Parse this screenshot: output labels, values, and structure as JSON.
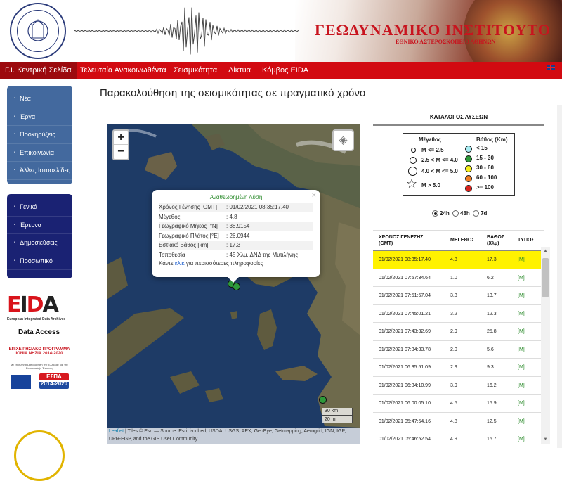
{
  "header": {
    "institute_title": "ΓΕΩΔΥΝΑΜΙΚΟ ΙΝΣΤΙΤΟΥΤΟ",
    "institute_subtitle": "ΕΘΝΙΚΟ ΑΣΤΕΡΟΣΚΟΠΕΙΟ ΑΘΗΝΩΝ",
    "logo_text": "NATIONAL OBSERVATORY ATHENS"
  },
  "nav": {
    "items": [
      "Γ.Ι. Κεντρική Σελίδα",
      "Τελευταία Ανακοινωθέντα",
      "Σεισμικότητα",
      "Δίκτυα",
      "Κόμβος EIDA"
    ],
    "language_flag_icon": "uk-flag-icon"
  },
  "sidebar": {
    "group1": [
      "Νέα",
      "Έργα",
      "Προκηρύξεις",
      "Επικοινωνία",
      "Άλλες Ιστοσελίδες"
    ],
    "group2": [
      "Γενικά",
      "Έρευνα",
      "Δημοσιεύσεις",
      "Προσωπικό"
    ],
    "eida_logo": "EIDA",
    "eida_caption": "European Integrated Data Archives",
    "data_access": "Data Access",
    "espa_program": "ΕΠΙΧΕΙΡΗΣΙΑΚΟ ΠΡΟΓΡΑΜΜΑ ΙΟΝΙΑ ΝΗΣΙΑ 2014-2020",
    "espa_cofunding": "Με τη συγχρηματοδότηση της Ελλάδας και της Ευρωπαϊκής Ένωσης",
    "espa_logo": "ΕΣΠΑ 2014-2020"
  },
  "page_title": "Παρακολούθηση της σεισμικότητας σε πραγματικό χρόνο",
  "map": {
    "zoom_in": "+",
    "zoom_out": "−",
    "scale_km": "30 km",
    "scale_mi": "20 mi",
    "attribution_leaflet": "Leaflet",
    "attribution": "| Tiles © Esri — Source: Esri, i-cubed, USDA, USGS, AEX, GeoEye, Getmapping, Aerogrid, IGN, IGP, UPR-EGP, and the GIS User Community",
    "popup": {
      "title": "Αναθεωρημένη Λύση",
      "close": "×",
      "rows": [
        {
          "k": "Χρόνος Γένησης [GMT]",
          "v": ": 01/02/2021 08:35:17.40"
        },
        {
          "k": "Μέγεθος",
          "v": ": 4.8"
        },
        {
          "k": "Γεωγραφικό Μήκος [°N]",
          "v": ": 38.9154"
        },
        {
          "k": "Γεωγραφικό Πλάτος [°E]",
          "v": ": 26.0944"
        },
        {
          "k": "Εστιακό Βάθος [km]",
          "v": ": 17.3"
        },
        {
          "k": "Τοποθεσία",
          "v": ": 45 Χλμ. ΔΝΔ της Μυτιλήνης"
        }
      ],
      "footer_pre": "Κάντε ",
      "footer_link": "κλικ",
      "footer_post": " για περισσότερες πληροφορίες"
    }
  },
  "catalog": {
    "title": "ΚΑΤΑΛΟΓΟΣ ΛΥΣΕΩΝ",
    "legend": {
      "magnitude_header": "Μέγεθος",
      "depth_header": "Βάθος (Km)",
      "magnitudes": [
        "M <= 2.5",
        "2.5 < M <= 4.0",
        "4.0 < M <= 5.0",
        "M > 5.0"
      ],
      "depths": [
        {
          "label": "< 15",
          "color": "#a8ecf2"
        },
        {
          "label": "15 - 30",
          "color": "#2e9a3a"
        },
        {
          "label": "30 - 60",
          "color": "#f5ee1a"
        },
        {
          "label": "60 - 100",
          "color": "#f07c22"
        },
        {
          "label": ">= 100",
          "color": "#d8231d"
        }
      ]
    },
    "periods": [
      "24h",
      "48h",
      "7d"
    ],
    "selected_period": "24h",
    "columns": [
      "ΧΡΟΝΟΣ ΓΕΝΕΣΗΣ (GMT)",
      "ΜΕΓΕΘΟΣ",
      "ΒΑΘΟΣ (Χλμ)",
      "ΤΥΠΟΣ"
    ],
    "rows": [
      {
        "time": "01/02/2021 08:35:17.40",
        "mag": "4.8",
        "depth": "17.3",
        "type": "[M]"
      },
      {
        "time": "01/02/2021 07:57:34.64",
        "mag": "1.0",
        "depth": "6.2",
        "type": "[M]"
      },
      {
        "time": "01/02/2021 07:51:57.04",
        "mag": "3.3",
        "depth": "13.7",
        "type": "[M]"
      },
      {
        "time": "01/02/2021 07:45:01.21",
        "mag": "3.2",
        "depth": "12.3",
        "type": "[M]"
      },
      {
        "time": "01/02/2021 07:43:32.69",
        "mag": "2.9",
        "depth": "25.8",
        "type": "[M]"
      },
      {
        "time": "01/02/2021 07:34:33.78",
        "mag": "2.0",
        "depth": "5.6",
        "type": "[M]"
      },
      {
        "time": "01/02/2021 06:35:51.09",
        "mag": "2.9",
        "depth": "9.3",
        "type": "[M]"
      },
      {
        "time": "01/02/2021 06:34:10.99",
        "mag": "3.9",
        "depth": "16.2",
        "type": "[M]"
      },
      {
        "time": "01/02/2021 06:00:05.10",
        "mag": "4.5",
        "depth": "15.9",
        "type": "[M]"
      },
      {
        "time": "01/02/2021 05:47:54.16",
        "mag": "4.8",
        "depth": "12.5",
        "type": "[M]"
      },
      {
        "time": "01/02/2021 05:46:52.54",
        "mag": "4.9",
        "depth": "15.7",
        "type": "[M]"
      }
    ]
  },
  "colors": {
    "nav_red": "#d20a11",
    "sidebar_blue": "#43699e",
    "sidebar_navy": "#1a2273",
    "selected_row": "#fff200",
    "title_red": "#c8141e"
  }
}
